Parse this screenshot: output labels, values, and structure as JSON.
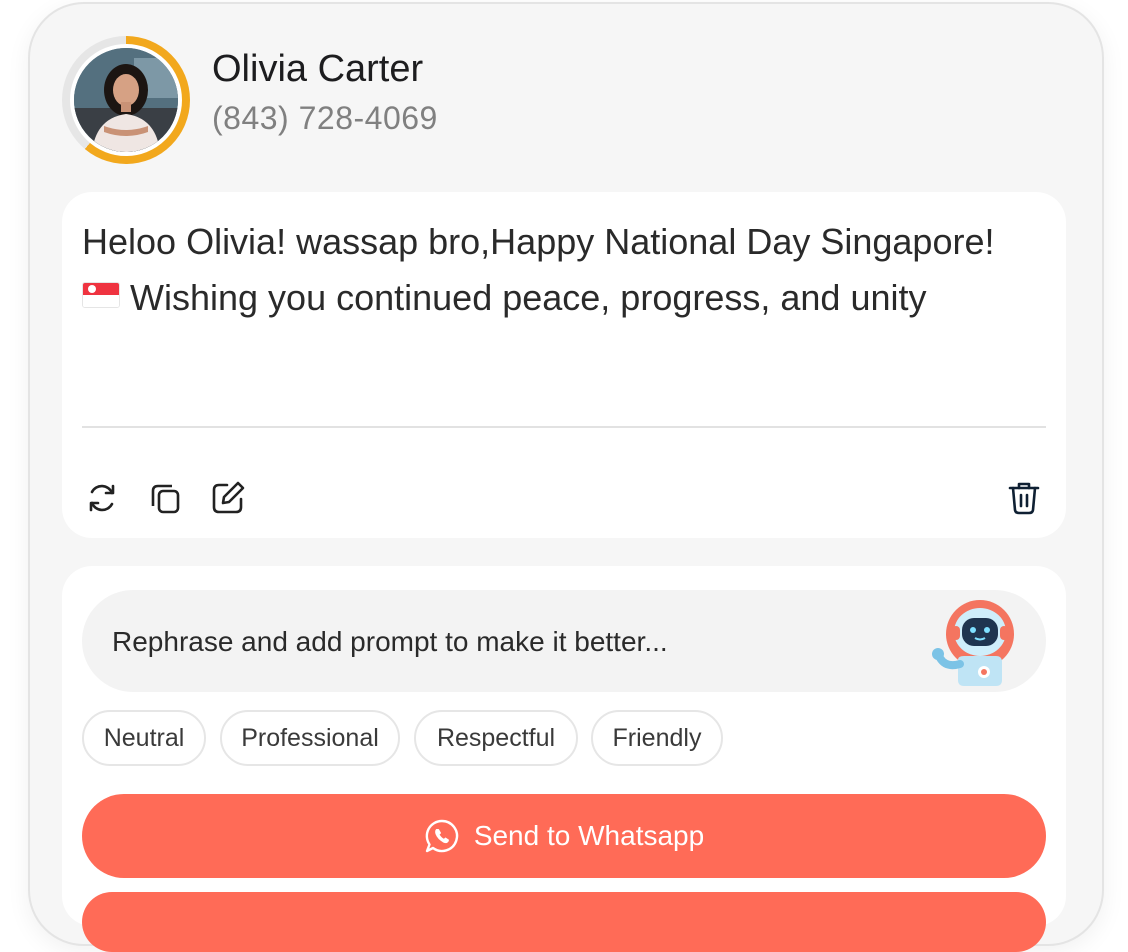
{
  "contact": {
    "name": "Olivia Carter",
    "phone": "(843) 728-4069",
    "avatar_icon": "profile-photo",
    "ring_color": "#f2a81d"
  },
  "message": {
    "text_before_flag": "Heloo Olivia! wassap bro,Happy National Day Singapore! ",
    "text_after_flag": " Wishing you continued peace, progress, and unity",
    "flag_icon": "singapore-flag",
    "actions": [
      "refresh-icon",
      "copy-icon",
      "edit-icon",
      "trash-icon"
    ]
  },
  "assistant": {
    "prompt_placeholder": "Rephrase and add prompt to make it better...",
    "robot_icon": "robot-assistant-icon",
    "tones": [
      "Neutral",
      "Professional",
      "Respectful",
      "Friendly"
    ],
    "send_label": "Send to Whatsapp",
    "send_icon": "whatsapp-icon",
    "accent_color": "#ff6b57"
  }
}
